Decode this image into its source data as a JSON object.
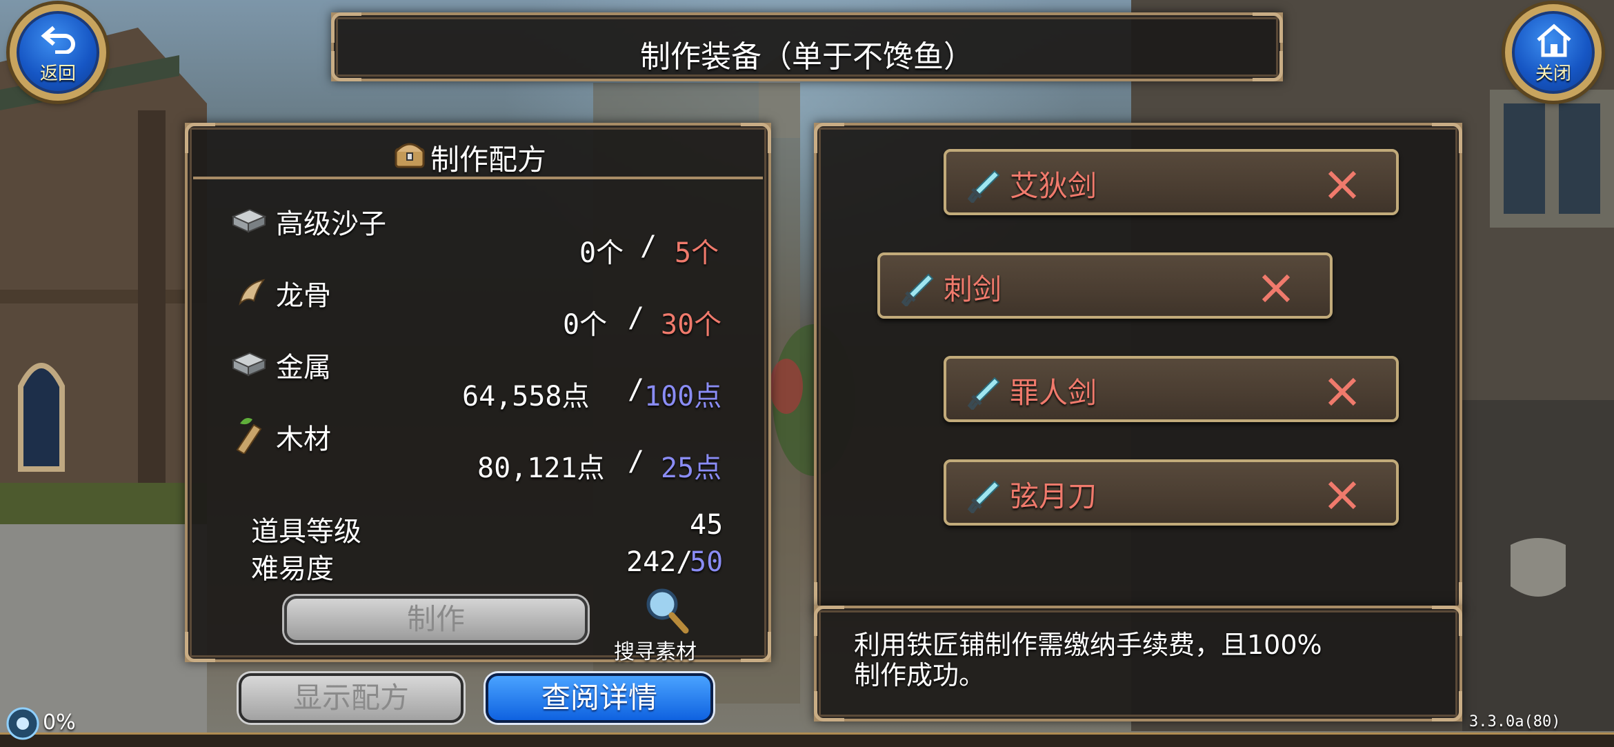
{
  "header": {
    "title": "制作装备（单于不馋鱼）"
  },
  "nav": {
    "back_label": "返回",
    "close_label": "关闭"
  },
  "recipe": {
    "title": "制作配方",
    "materials": [
      {
        "name": "高级沙子",
        "have": "0个",
        "sep": "/",
        "need": "5个",
        "need_color": "#f07a6c"
      },
      {
        "name": "龙骨",
        "have": "0个",
        "sep": "/",
        "need": "30个",
        "need_color": "#f07a6c"
      },
      {
        "name": "金属",
        "have": "64,558点",
        "sep": "/",
        "need": "100点",
        "need_color": "#8a8cf4"
      },
      {
        "name": "木材",
        "have": "80,121点",
        "sep": "/",
        "need": "25点",
        "need_color": "#8a8cf4"
      }
    ],
    "item_level_label": "道具等级",
    "item_level_value": "45",
    "difficulty_label": "难易度",
    "difficulty_value": "242/",
    "difficulty_max": "50",
    "craft_button": "制作",
    "search_label": "搜寻素材"
  },
  "bottom": {
    "show_recipe": "显示配方",
    "view_details": "查阅详情"
  },
  "weapons": [
    {
      "name": "艾狄剑"
    },
    {
      "name": "刺剑"
    },
    {
      "name": "罪人剑"
    },
    {
      "name": "弦月刀"
    }
  ],
  "info": {
    "line1": "利用铁匠铺制作需缴纳手续费，且100%",
    "line2": "制作成功。"
  },
  "status": {
    "progress": "0%",
    "version": "3.3.0a(80)"
  },
  "colors": {
    "accent_red": "#f07a6c",
    "accent_blue": "#8a8cf4",
    "frame_gold": "#c8a45e",
    "button_blue": "#1a6ff0"
  }
}
